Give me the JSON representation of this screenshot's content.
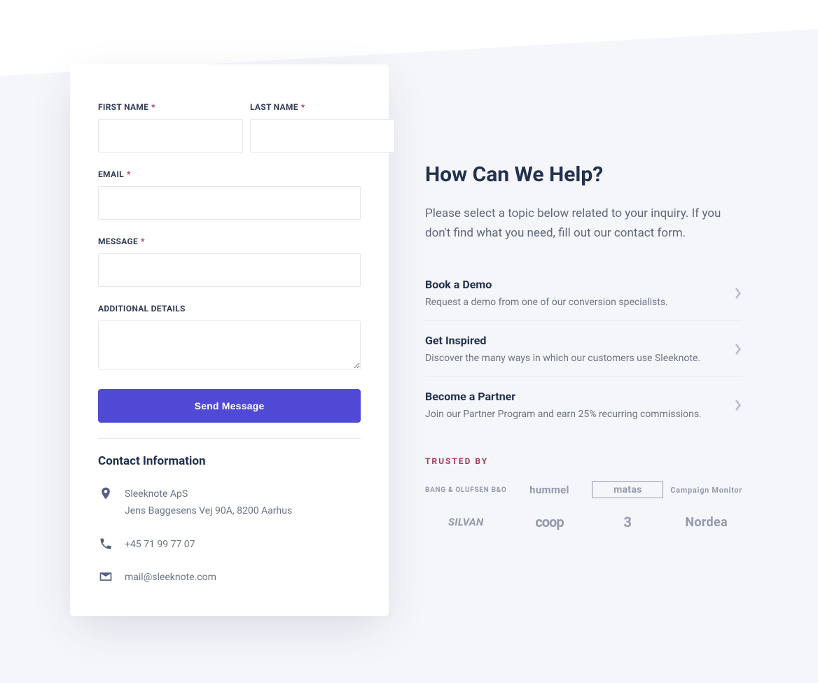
{
  "form": {
    "firstName": {
      "label": "FIRST NAME",
      "required": "*",
      "value": ""
    },
    "lastName": {
      "label": "LAST NAME",
      "required": "*",
      "value": ""
    },
    "email": {
      "label": "EMAIL",
      "required": "*",
      "value": ""
    },
    "message": {
      "label": "MESSAGE",
      "required": "*",
      "value": ""
    },
    "details": {
      "label": "ADDITIONAL DETAILS",
      "value": ""
    },
    "submit": "Send Message"
  },
  "contact": {
    "heading": "Contact Information",
    "company": "Sleeknote ApS",
    "address": "Jens Baggesens Vej 90A, 8200 Aarhus",
    "phone": "+45 71 99 77 07",
    "email": "mail@sleeknote.com"
  },
  "help": {
    "heading": "How Can We Help?",
    "lead": "Please select a topic below related to your inquiry. If you don't find what you need, fill out our contact form.",
    "items": [
      {
        "title": "Book a Demo",
        "desc": "Request a demo from one of our conversion specialists."
      },
      {
        "title": "Get Inspired",
        "desc": "Discover the many ways in which our customers use Sleeknote."
      },
      {
        "title": "Become a Partner",
        "desc": "Join our Partner Program and earn 25% recurring commissions."
      }
    ]
  },
  "trusted": {
    "label": "TRUSTED BY",
    "logos": [
      "BANG & OLUFSEN B&O",
      "hummel",
      "matas",
      "Campaign Monitor",
      "SILVAN",
      "coop",
      "3",
      "Nordea"
    ]
  }
}
